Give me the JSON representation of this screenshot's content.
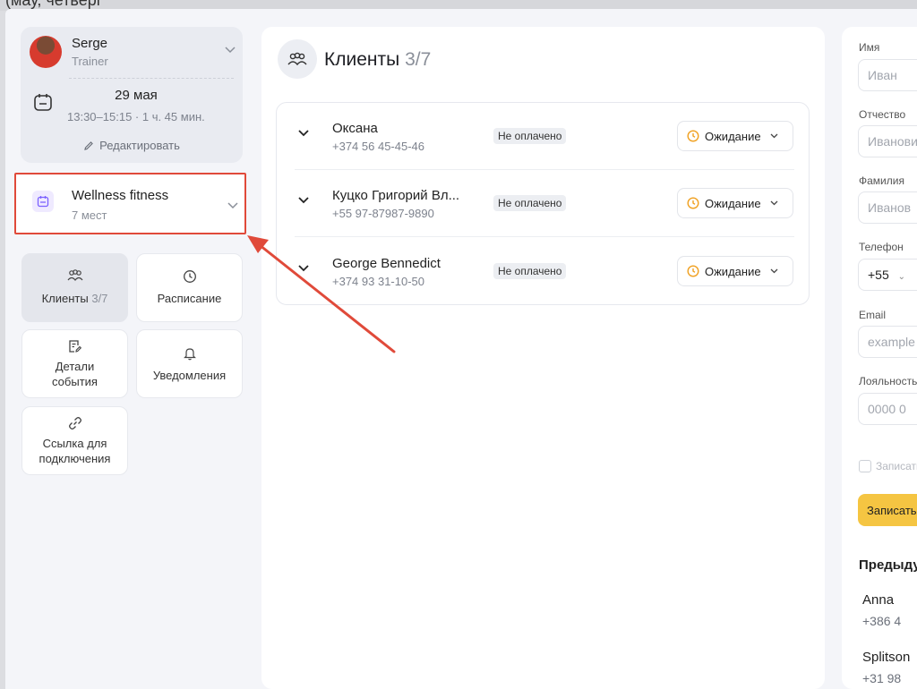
{
  "window_title_fragment": "(мау, четверг",
  "trainer": {
    "name": "Serge",
    "role": "Trainer",
    "date": "29 мая",
    "time": "13:30–15:15 · 1 ч. 45 мин.",
    "edit_label": "Редактировать"
  },
  "event": {
    "title": "Wellness fitness",
    "subtitle": "7 мест"
  },
  "nav": {
    "clients_label": "Клиенты",
    "clients_count": "3/7",
    "schedule_label": "Расписание",
    "details_line1": "Детали",
    "details_line2": "события",
    "notifications_label": "Уведомления",
    "link_line1": "Ссылка для",
    "link_line2": "подключения"
  },
  "main": {
    "title": "Клиенты",
    "count": "3/7",
    "clients": [
      {
        "name": "Оксана",
        "phone": "+374 56 45-45-46",
        "payment": "Не оплачено",
        "status": "Ожидание"
      },
      {
        "name": "Куцко Григорий Вл...",
        "phone": "+55 97-87987-9890",
        "payment": "Не оплачено",
        "status": "Ожидание"
      },
      {
        "name": "George Bennedict",
        "phone": "+374 93 31-10-50",
        "payment": "Не оплачено",
        "status": "Ожидание"
      }
    ]
  },
  "form": {
    "first_name_label": "Имя",
    "first_name_placeholder": "Иван",
    "patronymic_label": "Отчество",
    "patronymic_placeholder": "Иванович",
    "last_name_label": "Фамилия",
    "last_name_placeholder": "Иванов",
    "phone_label": "Телефон",
    "phone_code": "+55",
    "email_label": "Email",
    "email_placeholder": "example",
    "loyalty_label": "Лояльность",
    "loyalty_placeholder": "0000 0",
    "checkbox_label": "Записать",
    "submit_label": "Записать",
    "previous_heading": "Предыдущие",
    "previous": [
      {
        "name": "Anna",
        "phone": "+386 4"
      },
      {
        "name": "Splitson",
        "phone": "+31 98"
      }
    ]
  },
  "colors": {
    "accent_yellow": "#f5c542",
    "highlight_red": "#e04a3a",
    "status_orange": "#f0a020",
    "event_purple": "#7b61ff"
  }
}
